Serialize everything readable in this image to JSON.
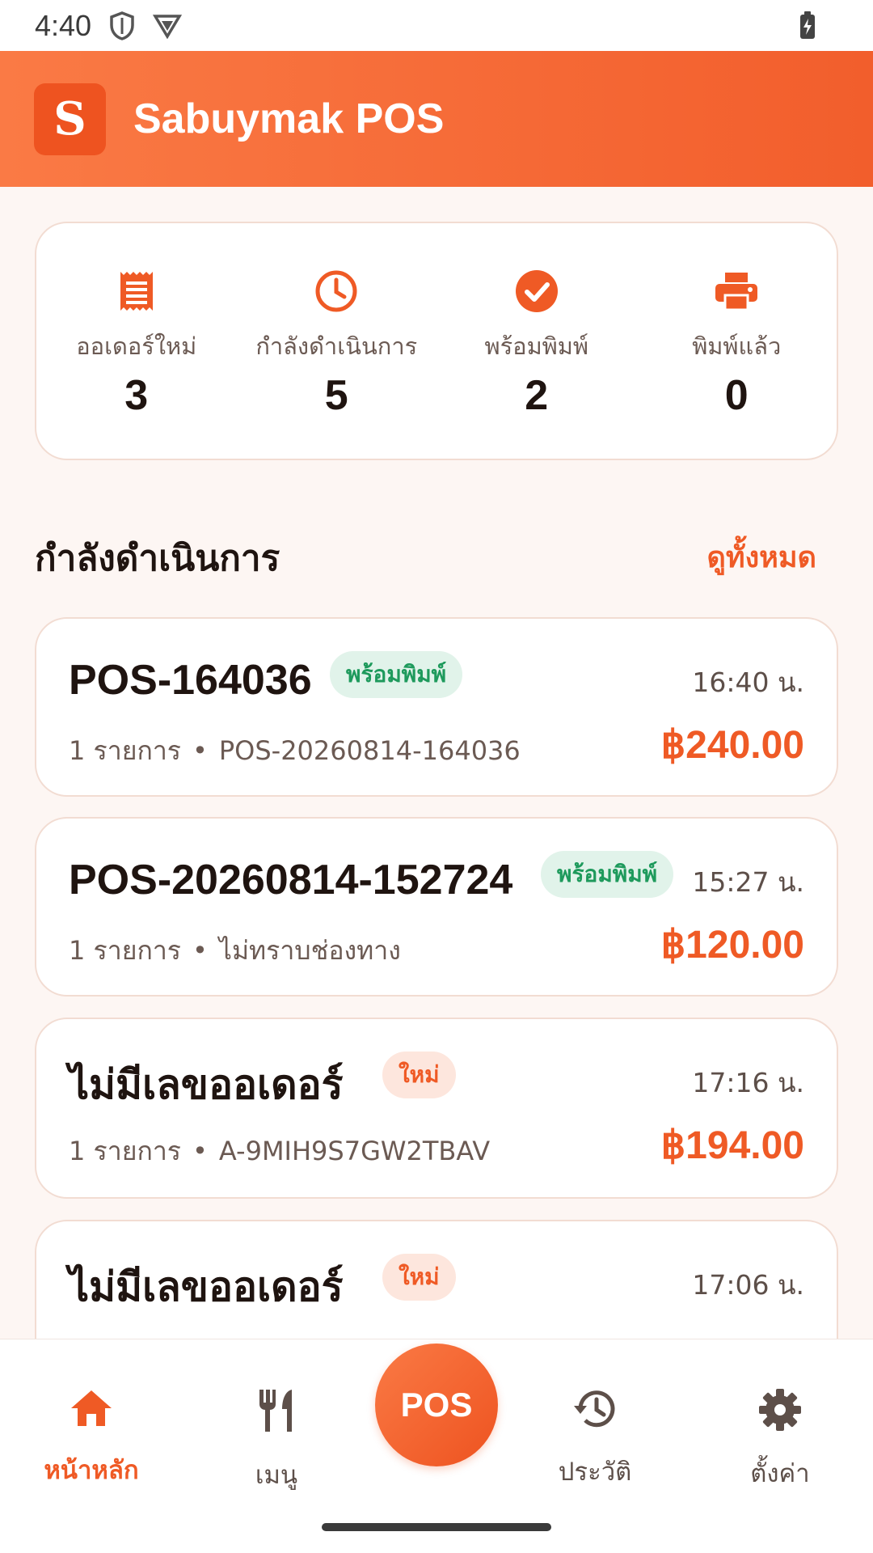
{
  "status_bar": {
    "time": "4:40"
  },
  "app": {
    "logo_letter": "S",
    "title": "Sabuymak POS",
    "accent": "#ef5a25"
  },
  "stats": [
    {
      "icon": "receipt-icon",
      "label": "ออเดอร์ใหม่",
      "value": "3"
    },
    {
      "icon": "clock-icon",
      "label": "กำลังดำเนินการ",
      "value": "5"
    },
    {
      "icon": "check-circle-icon",
      "label": "พร้อมพิมพ์",
      "value": "2"
    },
    {
      "icon": "printer-icon",
      "label": "พิมพ์แล้ว",
      "value": "0"
    }
  ],
  "section": {
    "title": "กำลังดำเนินการ",
    "view_all": "ดูทั้งหมด"
  },
  "orders": [
    {
      "id": "POS-164036",
      "badge": "พร้อมพิมพ์",
      "badge_type": "ready",
      "time": "16:40 น.",
      "items": "1 รายการ",
      "dot": "•",
      "channel": "POS-20260814-164036",
      "amount": "฿240.00"
    },
    {
      "id": "POS-20260814-152724",
      "badge": "พร้อมพิมพ์",
      "badge_type": "ready",
      "time": "15:27 น.",
      "items": "1 รายการ",
      "dot": "•",
      "channel": "ไม่ทราบช่องทาง",
      "amount": "฿120.00"
    },
    {
      "id": "ไม่มีเลขออเดอร์",
      "badge": "ใหม่",
      "badge_type": "new",
      "time": "17:16 น.",
      "items": "1 รายการ",
      "dot": "•",
      "channel": "A-9MIH9S7GW2TBAV",
      "amount": "฿194.00"
    },
    {
      "id": "ไม่มีเลขออเดอร์",
      "badge": "ใหม่",
      "badge_type": "new",
      "time": "17:06 น."
    }
  ],
  "bottom_nav": {
    "home": "หน้าหลัก",
    "menu": "เมนู",
    "pos": "POS",
    "history": "ประวัติ",
    "settings": "ตั้งค่า"
  }
}
